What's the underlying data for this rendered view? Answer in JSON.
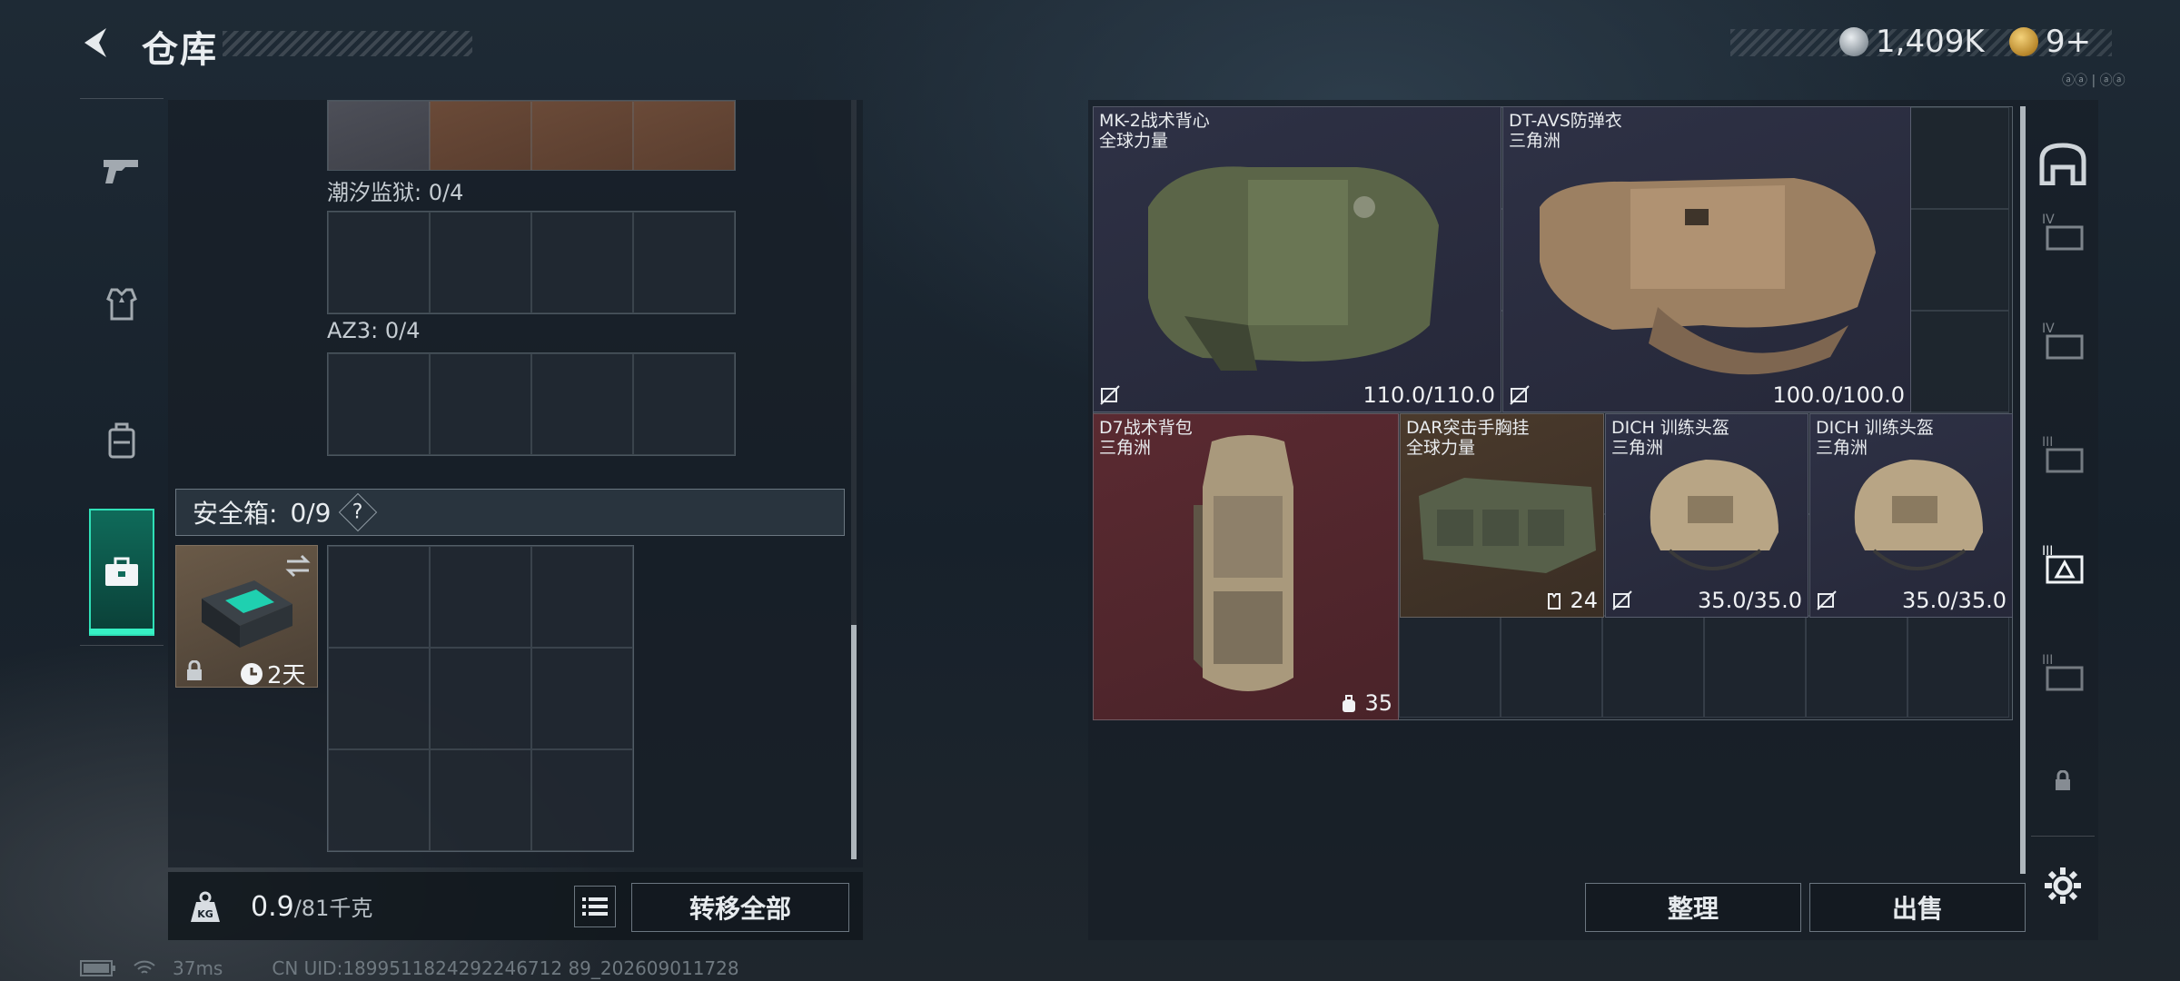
{
  "header": {
    "title": "仓库"
  },
  "currency": {
    "silver": "1,409K",
    "gold": "9+"
  },
  "corner_text": "ⓐⓐ | ⓐⓐ",
  "left_panel": {
    "slot_tide_prison": "潮汐监狱: 0/4",
    "slot_az3": "AZ3: 0/4",
    "safe_header_label": "安全箱:",
    "safe_header_count": "0/9",
    "safe_help": "?",
    "safebox_timer": "2天"
  },
  "weight": {
    "current": "0.9",
    "max": "/81千克"
  },
  "buttons": {
    "transfer_all": "转移全部",
    "organize": "整理",
    "sell": "出售"
  },
  "status": {
    "ping": "37ms",
    "uid": "CN UID:1899511824292246712 89_202609011728"
  },
  "items": [
    {
      "name": "MK-2战术背心",
      "source": "全球力量",
      "value": "110.0/110.0"
    },
    {
      "name": "DT-AVS防弹衣",
      "source": "三角洲",
      "value": "100.0/100.0"
    },
    {
      "name": "D7战术背包",
      "source": "三角洲",
      "value": "35"
    },
    {
      "name": "DAR突击手胸挂",
      "source": "全球力量",
      "value": "24"
    },
    {
      "name": "DICH 训练头盔",
      "source": "三角洲",
      "value": "35.0/35.0"
    },
    {
      "name": "DICH 训练头盔",
      "source": "三角洲",
      "value": "35.0/35.0"
    }
  ],
  "colors": {
    "accent": "#2fe0b7",
    "item_red": "#5a2a31",
    "item_navy": "#2e3145",
    "item_brown": "#4a3a2c"
  }
}
